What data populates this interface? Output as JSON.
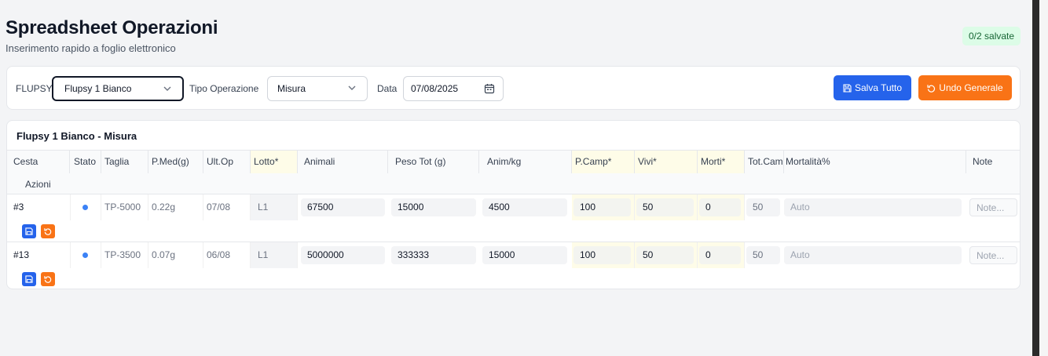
{
  "header": {
    "title": "Spreadsheet Operazioni",
    "subtitle": "Inserimento rapido a foglio elettronico",
    "saved_badge": "0/2 salvate"
  },
  "toolbar": {
    "flupsy_label": "FLUPSY",
    "flupsy_value": "Flupsy 1 Bianco",
    "op_label": "Tipo Operazione",
    "op_value": "Misura",
    "date_label": "Data",
    "date_value": "07/08/2025",
    "save_all": "Salva Tutto",
    "undo_all": "Undo Generale"
  },
  "table": {
    "title": "Flupsy 1 Bianco - Misura",
    "columns": [
      "Cesta",
      "Stato",
      "Taglia",
      "P.Med(g)",
      "Ult.Op",
      "Lotto*",
      "Animali",
      "Peso Tot (g)",
      "Anim/kg",
      "P.Camp*",
      "Vivi*",
      "Morti*",
      "Tot.Camp",
      "Mortalità%",
      "Note"
    ],
    "actions_header": "Azioni",
    "rows": [
      {
        "cesta": "#3",
        "taglia": "TP-5000",
        "pmed": "0.22g",
        "ultop": "07/08",
        "lotto": "L1",
        "animali": "67500",
        "peso": "15000",
        "animkg": "4500",
        "pcamp": "100",
        "vivi": "50",
        "morti": "0",
        "totcamp": "50",
        "mortalita": "Auto",
        "note": "Note..."
      },
      {
        "cesta": "#13",
        "taglia": "TP-3500",
        "pmed": "0.07g",
        "ultop": "06/08",
        "lotto": "L1",
        "animali": "5000000",
        "peso": "333333",
        "animkg": "15000",
        "pcamp": "100",
        "vivi": "50",
        "morti": "0",
        "totcamp": "50",
        "mortalita": "Auto",
        "note": "Note..."
      }
    ]
  },
  "colors": {
    "primary": "#2563eb",
    "undo": "#f97316",
    "status_dot": "#3b82f6",
    "badge_bg": "#dcfce7",
    "badge_text": "#166534",
    "required_col_bg": "#fefce8"
  }
}
